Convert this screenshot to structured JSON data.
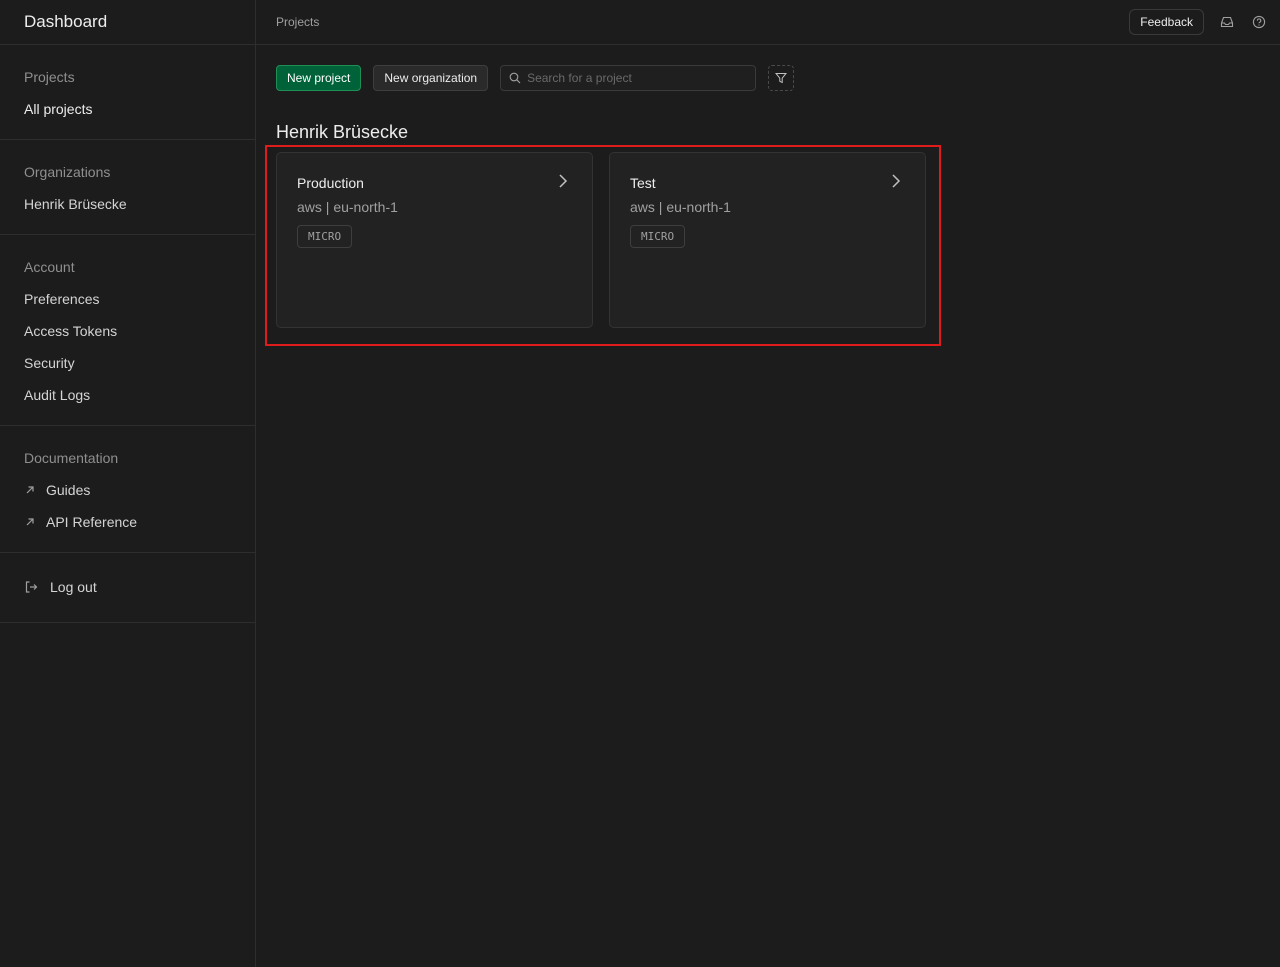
{
  "app": {
    "title": "Dashboard"
  },
  "sidebar": {
    "sections": [
      {
        "heading": "Projects",
        "items": [
          {
            "label": "All projects"
          }
        ]
      },
      {
        "heading": "Organizations",
        "items": [
          {
            "label": "Henrik Brüsecke"
          }
        ]
      },
      {
        "heading": "Account",
        "items": [
          {
            "label": "Preferences"
          },
          {
            "label": "Access Tokens"
          },
          {
            "label": "Security"
          },
          {
            "label": "Audit Logs"
          }
        ]
      },
      {
        "heading": "Documentation",
        "items": [
          {
            "label": "Guides",
            "icon": "external-link-icon"
          },
          {
            "label": "API Reference",
            "icon": "external-link-icon"
          }
        ]
      }
    ],
    "logout": {
      "label": "Log out",
      "icon": "logout-icon"
    }
  },
  "topbar": {
    "breadcrumb": "Projects",
    "feedback_label": "Feedback",
    "icons": [
      "inbox-icon",
      "help-icon"
    ]
  },
  "toolbar": {
    "new_project_label": "New project",
    "new_org_label": "New organization",
    "search_placeholder": "Search for a project",
    "search_value": "",
    "filter_icon": "filter-icon"
  },
  "organization": {
    "name": "Henrik Brüsecke",
    "projects": [
      {
        "name": "Production",
        "region": "aws | eu-north-1",
        "badge": "MICRO"
      },
      {
        "name": "Test",
        "region": "aws | eu-north-1",
        "badge": "MICRO"
      }
    ]
  },
  "colors": {
    "background": "#1c1c1c",
    "primary": "#006239",
    "highlight": "#e01b1b"
  }
}
